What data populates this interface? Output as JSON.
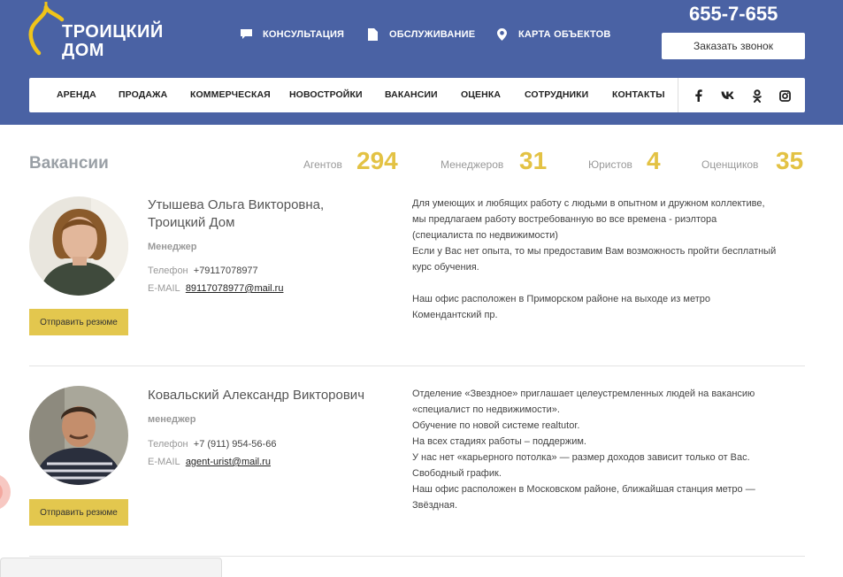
{
  "brand": {
    "line1": "ТРОИЦКИЙ",
    "line2": "ДОМ"
  },
  "top_links": [
    {
      "label": "КОНСУЛЬТАЦИЯ",
      "icon": "chat-icon"
    },
    {
      "label": "ОБСЛУЖИВАНИЕ",
      "icon": "document-icon"
    },
    {
      "label": "КАРТА ОБЪЕКТОВ",
      "icon": "map-pin-icon"
    }
  ],
  "phone": "655-7-655",
  "callback_label": "Заказать звонок",
  "nav": [
    "АРЕНДА",
    "ПРОДАЖА",
    "КОММЕРЧЕСКАЯ",
    "НОВОСТРОЙКИ",
    "ВАКАНСИИ",
    "ОЦЕНКА",
    "СОТРУДНИКИ",
    "КОНТАКТЫ"
  ],
  "social": [
    "facebook-icon",
    "vk-icon",
    "odnoklassniki-icon",
    "instagram-icon"
  ],
  "page_title": "Вакансии",
  "stats": [
    {
      "label": "Агентов",
      "value": "294"
    },
    {
      "label": "Менеджеров",
      "value": "31"
    },
    {
      "label": "Юристов",
      "value": "4"
    },
    {
      "label": "Оценщиков",
      "value": "35"
    }
  ],
  "vacancies": [
    {
      "name_line1": "Утышева Ольга Викторовна,",
      "name_line2": "Троицкий Дом",
      "role": "Менеджер",
      "phone_label": "Телефон",
      "phone": "+79117078977",
      "email_label": "E-MAIL",
      "email": "89117078977@mail.ru",
      "button": "Отправить резюме",
      "desc": [
        "Для умеющих и любящих работу с людьми в опытном и дружном коллективе,",
        "мы предлагаем работу востребованную во все времена - риэлтора",
        "(специалиста по недвижимости)",
        "Если у Вас нет опыта, то мы предоставим Вам возможность пройти бесплатный",
        "курс обучения.",
        "",
        "Наш офис расположен в Приморском районе на выходе из метро",
        "Комендантский пр."
      ]
    },
    {
      "name_line1": "Ковальский Александр Викторович",
      "name_line2": "",
      "role": "менеджер",
      "phone_label": "Телефон",
      "phone": "+7 (911) 954-56-66",
      "email_label": "E-MAIL",
      "email": "agent-urist@mail.ru",
      "button": "Отправить резюме",
      "desc": [
        "Отделение «Звездное» приглашает целеустремленных людей на вакансию",
        "«специалист по недвижимости».",
        "Обучение по новой системе realtutor.",
        "На всех стадиях работы – поддержим.",
        "У нас нет «карьерного потолка» — размер доходов зависит только от Вас.",
        "Свободный график.",
        "Наш офис расположен в Московском районе, ближайшая станция метро —",
        "Звёздная."
      ]
    }
  ],
  "colors": {
    "header_bg": "#4a62a4",
    "accent_yellow": "#e3c244",
    "button_yellow": "#e3c74e"
  }
}
